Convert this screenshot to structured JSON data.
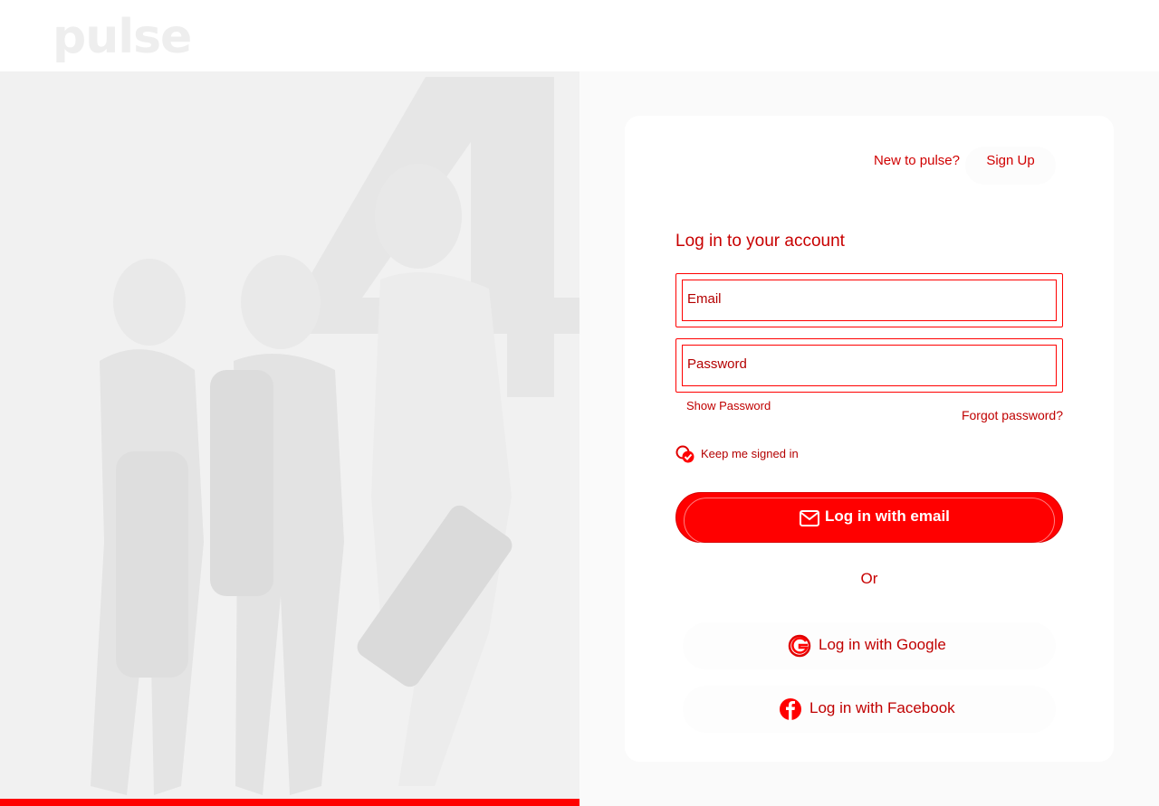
{
  "brand": {
    "logo": "pulse"
  },
  "signup": {
    "prompt": "New to pulse?",
    "link": "Sign Up"
  },
  "login": {
    "heading": "Log in to your account",
    "email_label": "Email",
    "password_label": "Password",
    "show_password": "Show Password",
    "forgot_password": "Forgot password?",
    "keep_signed_in": "Keep me signed in",
    "email_button": "Log in with email",
    "or": "Or",
    "google_button": "Log in with Google",
    "facebook_button": "Log in with Facebook"
  },
  "colors": {
    "accent": "#ff0000",
    "text_accent": "#c80000",
    "logo": "#eeeeee"
  },
  "icons": {
    "email_button": "envelope-icon",
    "google_button": "google-icon",
    "facebook_button": "facebook-icon",
    "keep_signed_in": "checkbox-checked-icon"
  }
}
